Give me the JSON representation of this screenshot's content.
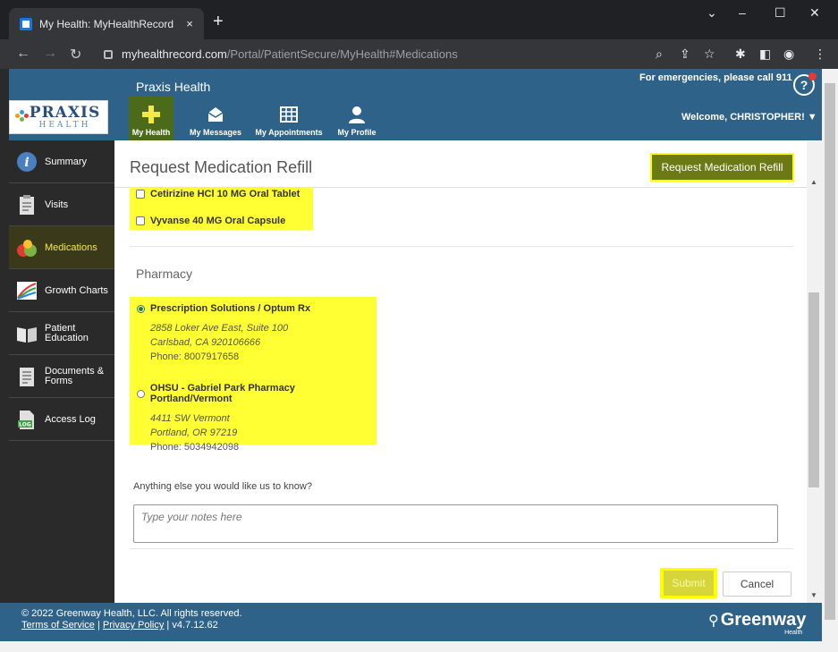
{
  "browser": {
    "tab_title": "My Health: MyHealthRecord",
    "tab_close": "×",
    "new_tab": "+",
    "url_domain": "myhealthrecord.com",
    "url_path": "/Portal/PatientSecure/MyHealth#Medications",
    "window_controls": {
      "minimize": "–",
      "maximize": "☐",
      "close": "✕",
      "chevron": "⌄"
    }
  },
  "header": {
    "brand": "Praxis Health",
    "logo_text": "PRAXIS",
    "logo_sub": "HEALTH",
    "emergency_text": "For emergencies, please call 911",
    "help": "?",
    "welcome": "Welcome, CHRISTOPHER!  ▼",
    "nav": [
      {
        "label": "My Health"
      },
      {
        "label": "My Messages"
      },
      {
        "label": "My Appointments"
      },
      {
        "label": "My Profile"
      }
    ]
  },
  "sidebar": {
    "items": [
      {
        "label": "Summary"
      },
      {
        "label": "Visits"
      },
      {
        "label": "Medications"
      },
      {
        "label": "Growth Charts"
      },
      {
        "label": "Patient Education"
      },
      {
        "label": "Documents & Forms"
      },
      {
        "label": "Access Log"
      }
    ]
  },
  "main": {
    "title": "Request Medication Refill",
    "top_button": "Request Medication Refill",
    "medications": [
      {
        "name": "Cetirizine HCl 10 MG Oral Tablet",
        "checked": false
      },
      {
        "name": "Vyvanse 40 MG Oral Capsule",
        "checked": false
      }
    ],
    "pharmacy_label": "Pharmacy",
    "pharmacies": [
      {
        "name": "Prescription Solutions / Optum Rx",
        "address1": "2858 Loker Ave East, Suite 100",
        "address2": "Carlsbad, CA 920106666",
        "phone": "Phone: 8007917658",
        "selected": true
      },
      {
        "name": "OHSU - Gabriel Park Pharmacy Portland/Vermont",
        "address1": "4411 SW Vermont",
        "address2": "Portland, OR 97219",
        "phone": "Phone: 5034942098",
        "selected": false
      }
    ],
    "notes_label": "Anything else you would like us to know?",
    "notes_placeholder": "Type your notes here",
    "submit": "Submit",
    "cancel": "Cancel"
  },
  "footer": {
    "copyright": "© 2022 Greenway Health, LLC. All rights reserved.",
    "terms": "Terms of Service",
    "privacy": "Privacy Policy",
    "version": " | v4.7.12.62",
    "brand": "Greenway",
    "brand_sub": "Health"
  },
  "colors": {
    "header_blue": "#2e6288",
    "highlight_yellow": "#ffff33",
    "active_nav_green": "#4b6a1a",
    "sidebar_dark": "#2a2a2a"
  }
}
